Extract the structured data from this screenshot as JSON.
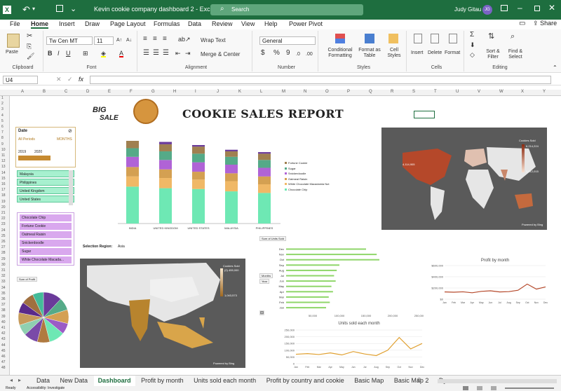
{
  "title_bar": {
    "save_label": "AutoSave",
    "doc_title": "Kevin cookie company dashboard 2 - Excel",
    "search_placeholder": "Search",
    "user_name": "Judy Gitau",
    "user_initials": "JG"
  },
  "menu": [
    "File",
    "Home",
    "Insert",
    "Draw",
    "Page Layout",
    "Formulas",
    "Data",
    "Review",
    "View",
    "Help",
    "Power Pivot"
  ],
  "active_menu": "Home",
  "share_label": "Share",
  "ribbon": {
    "clipboard": "Clipboard",
    "paste": "Paste",
    "font": "Font",
    "font_name": "Tw Cen MT",
    "font_size": "11",
    "alignment": "Alignment",
    "wrap_text": "Wrap Text",
    "merge_center": "Merge & Center",
    "number": "Number",
    "number_format": "General",
    "styles": "Styles",
    "cond_format": "Conditional Formatting",
    "format_table": "Format as Table",
    "cell_styles": "Cell Styles",
    "cells": "Cells",
    "insert": "Insert",
    "delete": "Delete",
    "format": "Format",
    "editing": "Editing",
    "sort_filter": "Sort & Filter",
    "find_select": "Find & Select"
  },
  "formula_bar": {
    "name_box": "U4",
    "formula": ""
  },
  "columns": [
    "A",
    "B",
    "C",
    "D",
    "E",
    "F",
    "G",
    "H",
    "I",
    "J",
    "K",
    "L",
    "M",
    "N",
    "O",
    "P",
    "Q",
    "R",
    "S",
    "T",
    "U",
    "V",
    "W",
    "X",
    "Y"
  ],
  "dashboard": {
    "title": "COOKIE SALES REPORT",
    "logo_line1": "BIG",
    "logo_line2": "SALE",
    "date_slicer": {
      "title": "Date",
      "all_periods": "All Periods",
      "months_label": "MONTHS",
      "year_a": "2019",
      "year_b": "2020"
    },
    "country_slicer": [
      "Malaysia",
      "Philippines",
      "United Kingdom",
      "United States"
    ],
    "product_slicer": [
      "Chocolate Chip",
      "Fortune Cookie",
      "Oatmeal Raisin",
      "Snickerdoodle",
      "Sugar",
      "White Chocolate Macada..."
    ],
    "selection_region_label": "Selection Region:",
    "selection_region_value": "Asia",
    "pie_label": "Sum of Profit",
    "units_sold_label": "Sum of Units Sold",
    "months_filter": "Months",
    "year_filter": "Year"
  },
  "stacked_bar": {
    "type": "bar",
    "categories": [
      "INDIA",
      "UNITED KINGDOM",
      "UNITED STATES",
      "MALAYSIA",
      "PHILIPPINES"
    ],
    "series": [
      {
        "name": "Chocolate Chip",
        "color": "#6ee8b4",
        "values": [
          0.47,
          0.45,
          0.44,
          0.41,
          0.39
        ]
      },
      {
        "name": "White Chocolate Macadamia Nut",
        "color": "#f0b866",
        "values": [
          0.13,
          0.13,
          0.12,
          0.13,
          0.11
        ]
      },
      {
        "name": "Oatmeal Raisin",
        "color": "#d4a052",
        "values": [
          0.12,
          0.11,
          0.1,
          0.1,
          0.1
        ]
      },
      {
        "name": "Snickerdoodle",
        "color": "#b063d6",
        "values": [
          0.13,
          0.12,
          0.12,
          0.11,
          0.11
        ]
      },
      {
        "name": "Sugar",
        "color": "#55aa88",
        "values": [
          0.11,
          0.11,
          0.11,
          0.1,
          0.1
        ]
      },
      {
        "name": "Fortune Cookie",
        "color": "#a08050",
        "values": [
          0.1,
          0.09,
          0.09,
          0.07,
          0.08
        ]
      },
      {
        "name": "Top",
        "color": "#6a3a9a",
        "values": [
          0.03,
          0.03,
          0.02,
          0.02,
          0.02
        ]
      }
    ],
    "legend": [
      "Fortune Cookie",
      "Sugar",
      "Snickerdoodle",
      "Oatmeal Raisin",
      "White Chocolate Macadamia Nut",
      "Chocolate Chip"
    ]
  },
  "world_map": {
    "legend_title": "Cookies Sold",
    "max_label": "6,214,224",
    "min_label": "4,114,905",
    "low_label": "1,012,015",
    "credit": "Powered by Bing"
  },
  "asia_map": {
    "legend_title": "Cookies Sold",
    "max_label": "(0) 455,000",
    "min_label": "1,043,573",
    "credit": "Powered by Bing"
  },
  "units_by_month": {
    "type": "bar",
    "categories": [
      "Dec",
      "Nov",
      "Oct",
      "Sep",
      "Aug",
      "Jul",
      "Jun",
      "May",
      "Apr",
      "Mar",
      "Feb",
      "Jan"
    ],
    "values": [
      150000,
      170000,
      175000,
      100000,
      95000,
      90000,
      93000,
      85000,
      88000,
      80000,
      82000,
      75000
    ],
    "xticks": [
      "50,000",
      "100,000",
      "150,000",
      "200,000",
      "250,000"
    ],
    "xlim": [
      0,
      250000
    ]
  },
  "profit_by_month": {
    "type": "line",
    "title": "Profit by month",
    "categories": [
      "Jan",
      "Feb",
      "Mar",
      "Apr",
      "May",
      "Jun",
      "Jul",
      "Aug",
      "Sep",
      "Oct",
      "Nov",
      "Dec"
    ],
    "values": [
      130000,
      125000,
      132000,
      115000,
      140000,
      150000,
      130000,
      135000,
      160000,
      270000,
      180000,
      220000
    ],
    "yticks": [
      "$0",
      "$200,000",
      "$400,000",
      "$600,000"
    ],
    "ylim": [
      0,
      600000
    ]
  },
  "units_each_month": {
    "type": "line",
    "title": "Units sold each month",
    "categories": [
      "Jan",
      "Feb",
      "Mar",
      "Apr",
      "May",
      "Jun",
      "Jul",
      "Aug",
      "Sep",
      "Oct",
      "Nov",
      "Dec"
    ],
    "values": [
      70000,
      75000,
      68000,
      80000,
      65000,
      90000,
      72000,
      60000,
      100000,
      195000,
      110000,
      150000
    ],
    "yticks": [
      "0",
      "50,000",
      "100,000",
      "150,000",
      "200,000",
      "250,000"
    ],
    "ylim": [
      0,
      250000
    ]
  },
  "pie": {
    "type": "pie",
    "colors": [
      "#6a3a9a",
      "#55aa88",
      "#d4a052",
      "#9b5cc6",
      "#6ee8b4",
      "#b07a40",
      "#7a4aa8",
      "#8fd0b0",
      "#c69a5a",
      "#5a2a8a",
      "#a07040",
      "#44bb99"
    ],
    "values": [
      12,
      8,
      9,
      7,
      10,
      8,
      9,
      7,
      8,
      7,
      8,
      7
    ]
  },
  "sheet_tabs": [
    "Data",
    "New Data",
    "Dashboard",
    "Profit by month",
    "Units sold each month",
    "Profit by country and cookie",
    "Basic Map",
    "Basic Map 2",
    "Dyna..."
  ],
  "active_tab": "Dashboard",
  "status": {
    "ready": "Ready",
    "accessibility": "Accessibility: Investigate"
  }
}
